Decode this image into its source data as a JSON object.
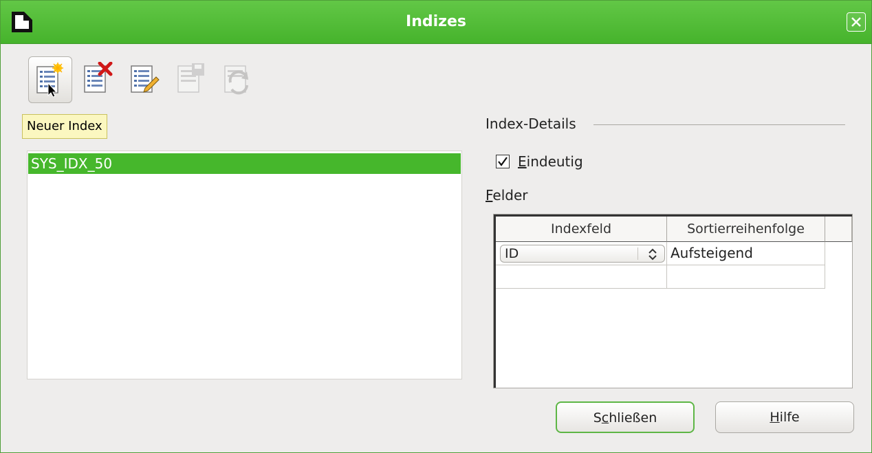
{
  "window": {
    "title": "Indizes",
    "app_icon": "document-icon",
    "close_icon": "close-icon"
  },
  "toolbar": {
    "buttons": [
      {
        "name": "new-index",
        "icon": "new-index-icon",
        "enabled": true,
        "active": true
      },
      {
        "name": "delete-index",
        "icon": "delete-index-icon",
        "enabled": true
      },
      {
        "name": "rename-index",
        "icon": "rename-index-icon",
        "enabled": true
      },
      {
        "name": "save-index",
        "icon": "save-index-icon",
        "enabled": false
      },
      {
        "name": "reset-index",
        "icon": "reset-index-icon",
        "enabled": false
      }
    ]
  },
  "tooltip": {
    "text": "Neuer Index"
  },
  "index_list": {
    "items": [
      "SYS_IDX_50"
    ],
    "selected": 0
  },
  "details": {
    "group_label": "Index-Details",
    "unique_checkbox": {
      "mnemonic": "E",
      "rest": "indeutig",
      "checked": true
    },
    "fields_label": {
      "mnemonic": "F",
      "rest": "elder"
    }
  },
  "fields_table": {
    "columns": [
      "Indexfeld",
      "Sortierreihenfolge"
    ],
    "rows": [
      {
        "field": "ID",
        "order": "Aufsteigend"
      },
      {
        "field": "",
        "order": ""
      }
    ]
  },
  "buttons": {
    "close": {
      "before": "S",
      "mnemonic": "c",
      "after": "hließen"
    },
    "help": {
      "mnemonic": "H",
      "rest": "ilfe"
    }
  },
  "colors": {
    "titlebar": "#55bd3b",
    "selection": "#46b72c",
    "tooltip_bg": "#fbf7c0",
    "dialog_bg": "#eeedec"
  }
}
